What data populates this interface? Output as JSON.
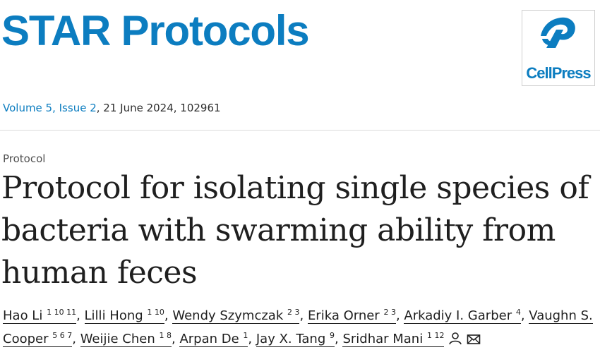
{
  "header": {
    "journal_title": "STAR Protocols",
    "publisher_logo_text": "CellPress",
    "publisher_logo_icon": "cellpress-logo-icon",
    "brand_color": "#0c7dc0"
  },
  "citation": {
    "volume_link": "Volume 5, Issue 2",
    "rest": ", 21 June 2024, 102961"
  },
  "article": {
    "type": "Protocol",
    "title": "Protocol for isolating single species of bacteria with swarming ability from human feces"
  },
  "authors": [
    {
      "name": "Hao Li",
      "sup": "1 10 11"
    },
    {
      "name": "Lilli Hong",
      "sup": "1 10"
    },
    {
      "name": "Wendy Szymczak",
      "sup": "2 3"
    },
    {
      "name": "Erika Orner",
      "sup": "2 3"
    },
    {
      "name": "Arkadiy I. Garber",
      "sup": "4"
    },
    {
      "name": "Vaughn S. Cooper",
      "sup": "5 6 7"
    },
    {
      "name": "Weijie Chen",
      "sup": "1 8"
    },
    {
      "name": "Arpan De",
      "sup": "1"
    },
    {
      "name": "Jay X. Tang",
      "sup": "9"
    },
    {
      "name": "Sridhar Mani",
      "sup": "1 12"
    }
  ],
  "icons": {
    "corresponding_author": "person-icon",
    "email": "envelope-icon"
  }
}
